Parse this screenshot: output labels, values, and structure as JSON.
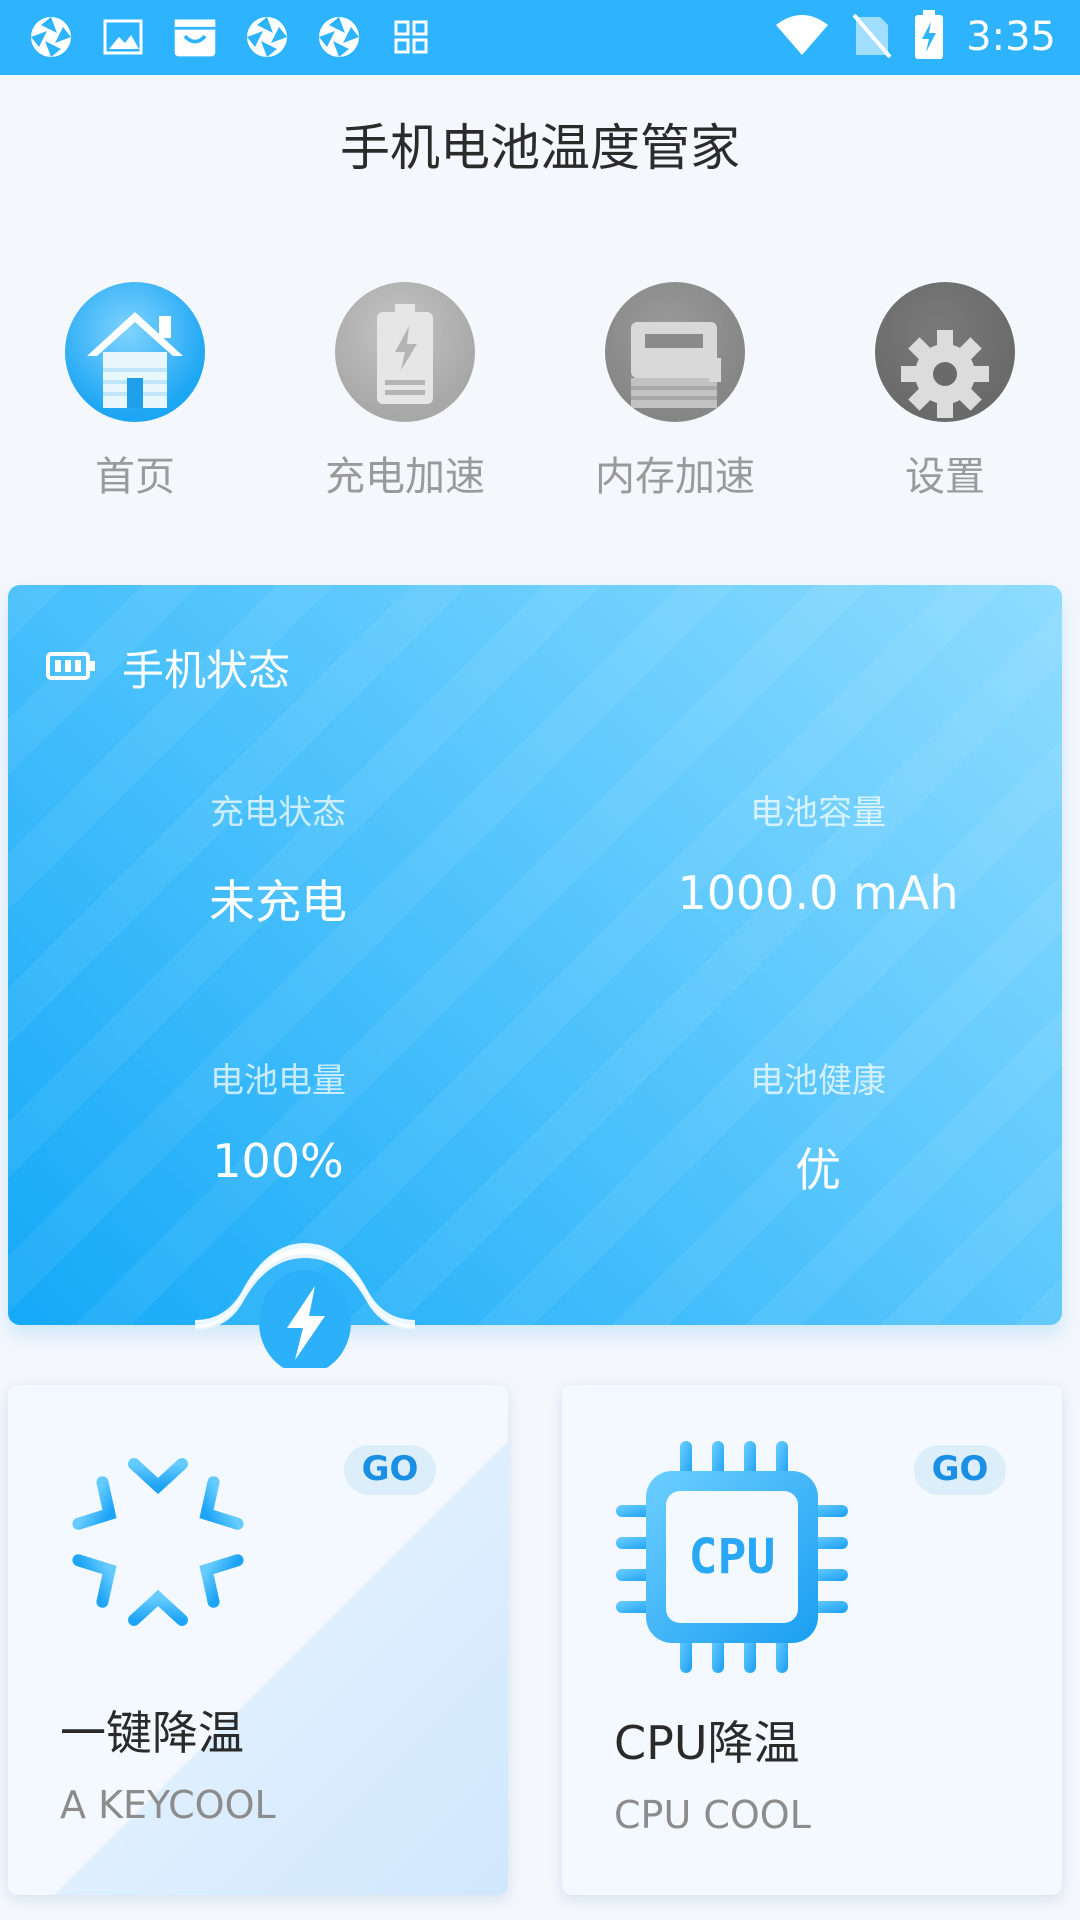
{
  "status_bar": {
    "time": "3:35",
    "left_icons": [
      "app-shutter-icon",
      "image-icon",
      "store-icon",
      "app-shutter-icon",
      "app-shutter-icon",
      "grid-icon"
    ],
    "right_icons": [
      "wifi-icon",
      "no-sim-icon",
      "battery-charging-icon"
    ]
  },
  "app": {
    "title": "手机电池温度管家"
  },
  "nav": [
    {
      "label": "首页",
      "icon": "home-icon",
      "active": true
    },
    {
      "label": "充电加速",
      "icon": "battery-charge-icon",
      "active": false
    },
    {
      "label": "内存加速",
      "icon": "memory-card-icon",
      "active": false
    },
    {
      "label": "设置",
      "icon": "gear-icon",
      "active": false
    }
  ],
  "status_card": {
    "title": "手机状态",
    "items": [
      {
        "label": "充电状态",
        "value": "未充电"
      },
      {
        "label": "电池容量",
        "value": "1000.0 mAh"
      },
      {
        "label": "电池电量",
        "value": "100%"
      },
      {
        "label": "电池健康",
        "value": "优"
      }
    ]
  },
  "cards": [
    {
      "title": "一键降温",
      "subtitle": "A KEYCOOL",
      "badge": "GO",
      "icon": "snowflake-icon"
    },
    {
      "title": "CPU降温",
      "subtitle": "CPU COOL",
      "badge": "GO",
      "icon": "cpu-chip-icon",
      "chip_text": "CPU"
    }
  ],
  "colors": {
    "accent": "#2eb3ff",
    "card_gradient_start": "#14a9f8",
    "card_gradient_end": "#8fdcff"
  }
}
